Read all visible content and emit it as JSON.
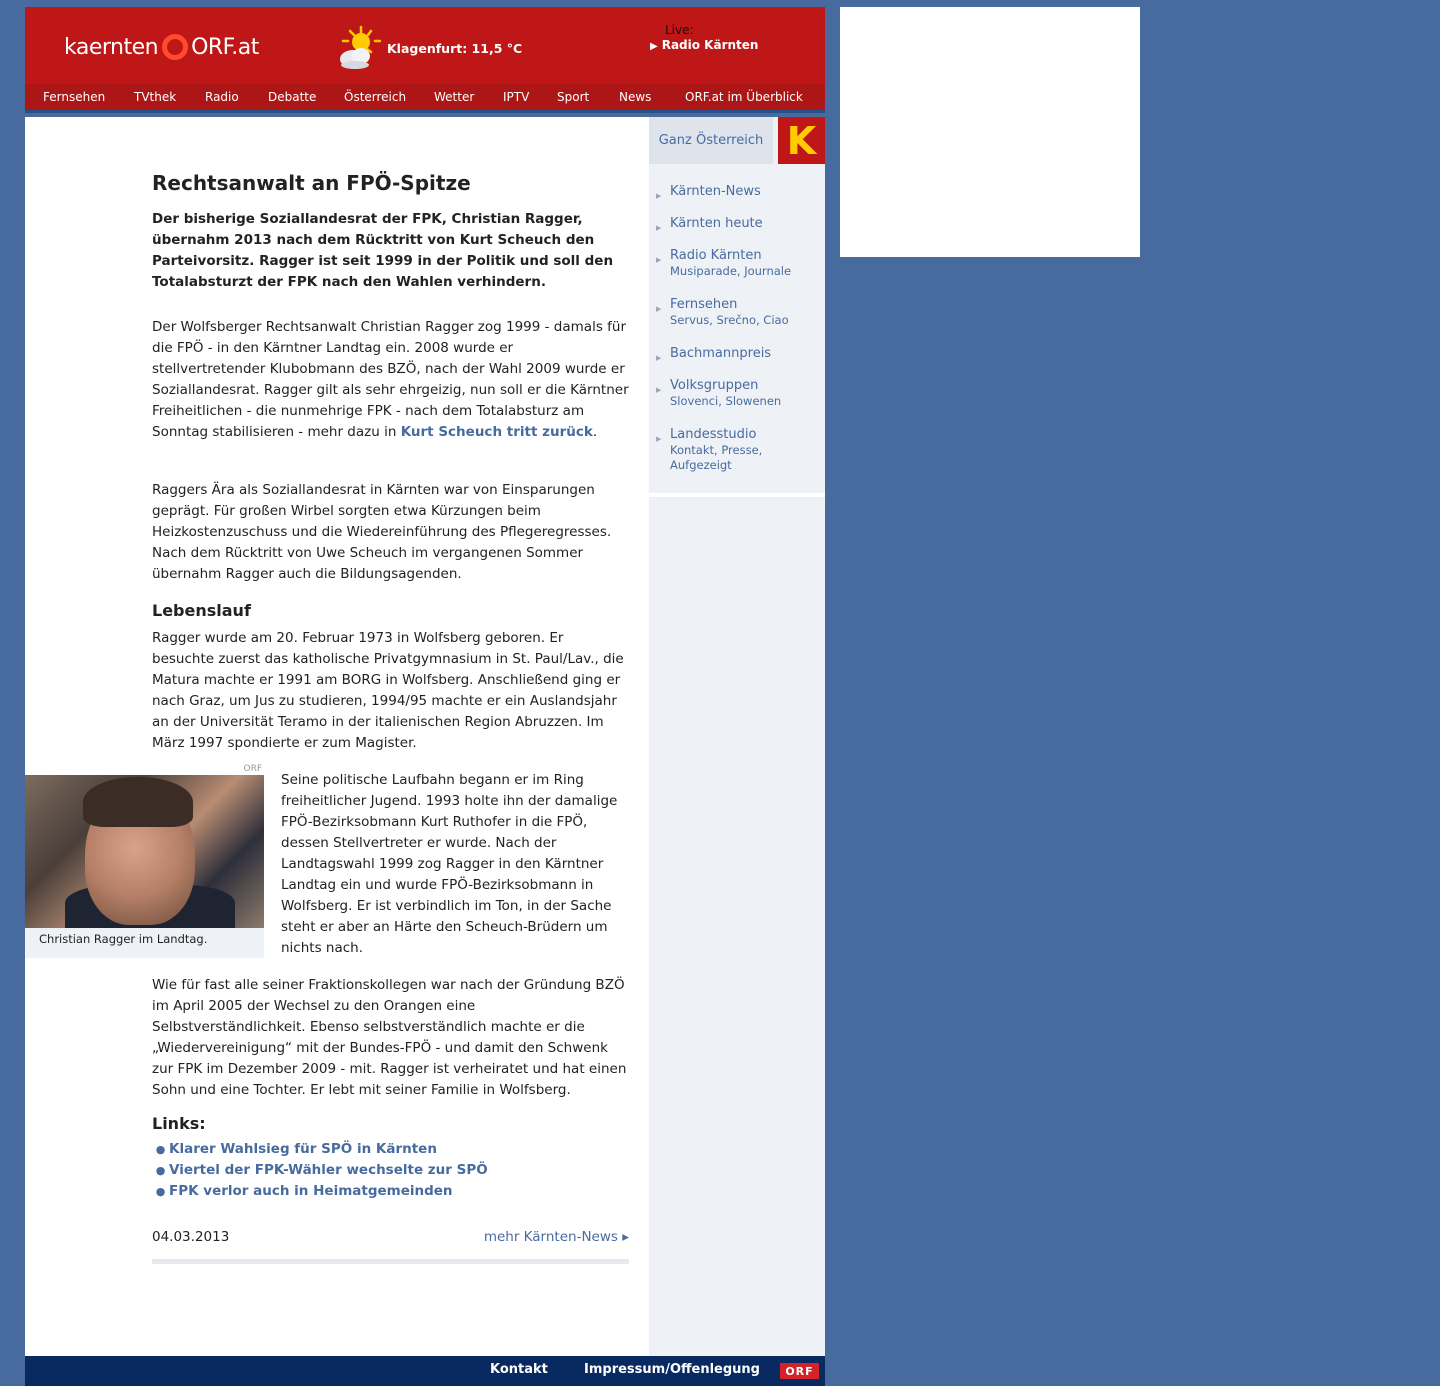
{
  "header": {
    "logo_region": "kaernten",
    "logo_brand": "ORF.at",
    "weather": "Klagenfurt: 11,5 °C",
    "live_label": "Live:",
    "live_station": "Radio Kärnten"
  },
  "nav": [
    "Fernsehen",
    "TVthek",
    "Radio",
    "Debatte",
    "Österreich",
    "Wetter",
    "IPTV",
    "Sport",
    "News",
    "ORF.at im Überblick"
  ],
  "article": {
    "title": "Rechtsanwalt an FPÖ-Spitze",
    "lead": "Der bisherige Soziallandesrat der FPK, Christian Ragger, übernahm 2013 nach dem Rücktritt von Kurt Scheuch den Parteivorsitz. Ragger ist seit 1999 in der Politik und soll den Totalabsturzt der FPK nach den Wahlen verhindern.",
    "p1_text": "Der Wolfsberger Rechtsanwalt Christian Ragger zog 1999 - damals für die FPÖ - in den Kärntner Landtag ein. 2008 wurde er stellvertretender Klubobmann des BZÖ, nach der Wahl 2009 wurde er Soziallandesrat. Ragger gilt als sehr ehrgeizig, nun soll er die Kärntner Freiheitlichen - die nunmehrige FPK - nach dem Totalabsturz am Sonntag stabilisieren - mehr dazu in ",
    "p1_link": "Kurt Scheuch tritt zurück",
    "p1_end": ".",
    "p2": "Raggers Ära als Soziallandesrat in Kärnten war von Einsparungen geprägt. Für großen Wirbel sorgten etwa Kürzungen beim Heizkostenzuschuss und die Wiedereinführung des Pflegeregresses. Nach dem Rücktritt von Uwe Scheuch im vergangenen Sommer übernahm Ragger auch die Bildungsagenden.",
    "h_lebenslauf": "Lebenslauf",
    "p3": "Ragger wurde am 20. Februar 1973 in Wolfsberg geboren. Er besuchte zuerst das katholische Privatgymnasium in St. Paul/Lav., die Matura machte er 1991 am BORG in Wolfsberg. Anschließend ging er nach Graz, um Jus zu studieren, 1994/95 machte er ein Auslandsjahr an der Universität Teramo in der italienischen Region Abruzzen. Im März 1997 spondierte er zum Magister.",
    "p4": "Seine politische Laufbahn begann er im Ring freiheitlicher Jugend. 1993 holte ihn der damalige FPÖ-Bezirksobmann Kurt Ruthofer in die FPÖ, dessen Stellvertreter er wurde. Nach der Landtagswahl 1999 zog Ragger in den Kärntner Landtag ein und wurde FPÖ-Bezirksobmann in Wolfsberg. Er ist verbindlich im Ton, in der Sache steht er aber an Härte den Scheuch-Brüdern um nichts nach.",
    "p5": "Wie für fast alle seiner Fraktionskollegen war nach der Gründung BZÖ im April 2005 der Wechsel zu den Orangen eine Selbstverständlichkeit. Ebenso selbstverständlich machte er die „Wiedervereinigung“ mit der Bundes-FPÖ - und damit den Schwenk zur FPK im Dezember 2009 - mit. Ragger ist verheiratet und hat einen Sohn und eine Tochter. Er lebt mit seiner Familie in Wolfsberg.",
    "image_credit": "ORF",
    "image_caption": "Christian Ragger im Landtag.",
    "links_heading": "Links:",
    "links": [
      "Klarer Wahlsieg für SPÖ in Kärnten",
      "Viertel der FPK-Wähler wechselte zur SPÖ",
      "FPK verlor auch in Heimatgemeinden"
    ],
    "date": "04.03.2013",
    "more": "mehr Kärnten-News ▸"
  },
  "sidebar": {
    "ganz": "Ganz Österreich",
    "badge": "K",
    "items": [
      {
        "label": "Kärnten-News",
        "sub": ""
      },
      {
        "label": "Kärnten heute",
        "sub": ""
      },
      {
        "label": "Radio Kärnten",
        "sub": "Musiparade,  Journale"
      },
      {
        "label": "Fernsehen",
        "sub": "Servus, Srečno, Ciao"
      },
      {
        "label": "Bachmannpreis",
        "sub": ""
      },
      {
        "label": "Volksgruppen",
        "sub": "Slovenci,  Slowenen"
      },
      {
        "label": "Landesstudio",
        "sub": "Kontakt,  Presse,\nAufgezeigt"
      }
    ]
  },
  "footer": {
    "kontakt": "Kontakt",
    "impressum": "Impressum/Offenlegung",
    "logo": "ORF"
  },
  "colors": {
    "header_red": "#bf1717",
    "link_blue": "#486b9f",
    "page_bg": "#486b9f",
    "footer_navy": "#082a61"
  }
}
